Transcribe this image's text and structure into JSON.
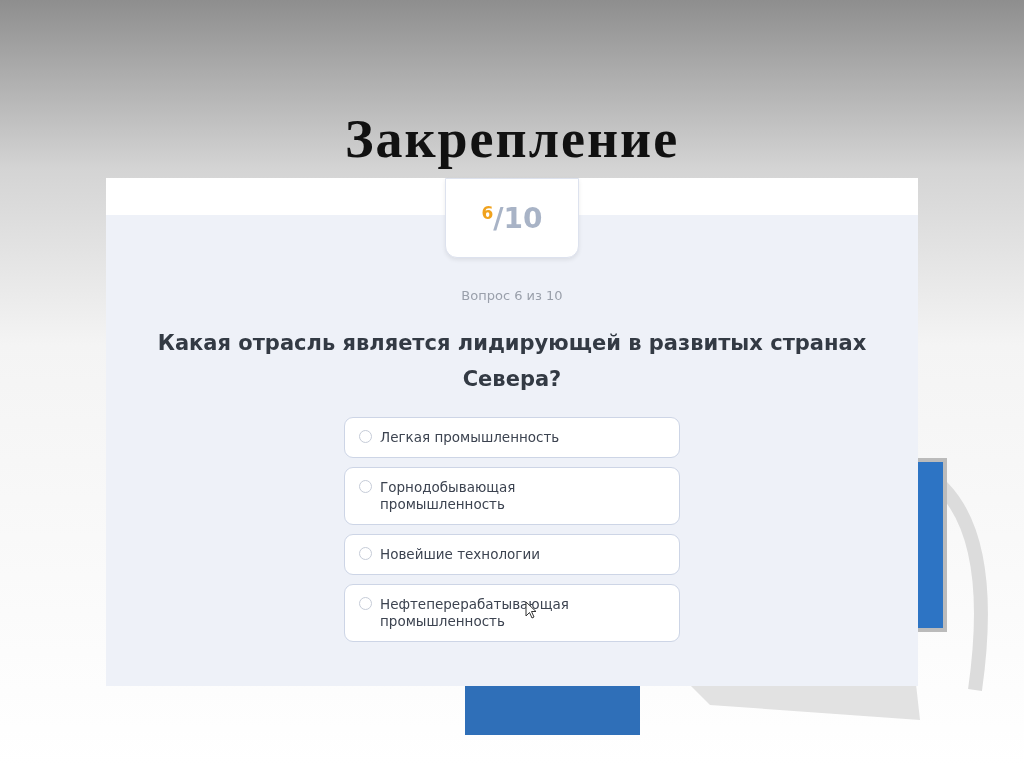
{
  "slide": {
    "title": "Закрепление"
  },
  "quiz": {
    "counter": {
      "current": "6",
      "total": "/10"
    },
    "progress_label": "Вопрос 6 из 10",
    "question": "Какая отрасль является лидирующей в развитых странах Севера?",
    "options": [
      {
        "label": "Легкая промышленность",
        "selected": false
      },
      {
        "label": "Горнодобывающая промышленность",
        "selected": false
      },
      {
        "label": "Новейшие технологии",
        "selected": false
      },
      {
        "label": "Нефтеперерабатывающая промышленность",
        "selected": false
      }
    ]
  }
}
